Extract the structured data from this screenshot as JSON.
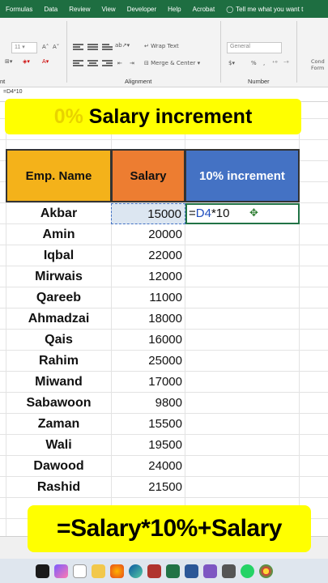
{
  "ribbon_tabs": {
    "formulas": "Formulas",
    "data": "Data",
    "review": "Review",
    "view": "View",
    "developer": "Developer",
    "help": "Help",
    "acrobat": "Acrobat",
    "tell_me": "Tell me what you want t"
  },
  "ribbon": {
    "font_size": "11",
    "wrap_text": "Wrap Text",
    "merge_center": "Merge & Center",
    "number_format": "General",
    "group_font_partial": "nt",
    "group_alignment": "Alignment",
    "group_number": "Number",
    "conditional_partial": "Cond Form",
    "percent_symbol": "%",
    "comma_symbol": ","
  },
  "formula_bar": {
    "content": "=D4*10"
  },
  "title_banner": {
    "prefix": "0%",
    "text": " Salary increment"
  },
  "table": {
    "headers": {
      "name": "Emp. Name",
      "salary": "Salary",
      "increment": "10% increment"
    },
    "rows": [
      {
        "name": "Akbar",
        "salary": "15000"
      },
      {
        "name": "Amin",
        "salary": "20000"
      },
      {
        "name": "Iqbal",
        "salary": "22000"
      },
      {
        "name": "Mirwais",
        "salary": "12000"
      },
      {
        "name": "Qareeb",
        "salary": "11000"
      },
      {
        "name": "Ahmadzai",
        "salary": "18000"
      },
      {
        "name": "Qais",
        "salary": "16000"
      },
      {
        "name": "Rahim",
        "salary": "25000"
      },
      {
        "name": "Miwand",
        "salary": "17000"
      },
      {
        "name": "Sabawoon",
        "salary": "9800"
      },
      {
        "name": "Zaman",
        "salary": "15500"
      },
      {
        "name": "Wali",
        "salary": "19500"
      },
      {
        "name": "Dawood",
        "salary": "24000"
      },
      {
        "name": "Rashid",
        "salary": "21500"
      }
    ],
    "active_formula": {
      "prefix": "=",
      "ref": "D4",
      "suffix": "*10"
    }
  },
  "bottom_banner": {
    "text": "=Salary*10%+Salary"
  },
  "colors": {
    "excel_green": "#1e6e41",
    "banner_yellow": "#ffff00",
    "header_name": "#f4b21a",
    "header_salary": "#ed7d31",
    "header_increment": "#4472c4"
  }
}
